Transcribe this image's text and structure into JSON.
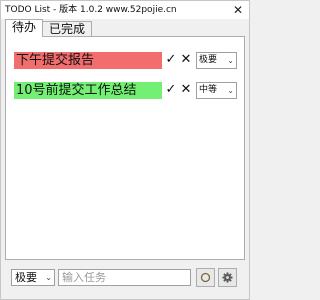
{
  "window": {
    "title": "TODO List - 版本 1.0.2 www.52pojie.cn",
    "close_label": "✕"
  },
  "tabs": [
    {
      "label": "待办",
      "selected": true
    },
    {
      "label": "已完成",
      "selected": false
    }
  ],
  "tasks": [
    {
      "text": "下午提交报告",
      "priority": "极要",
      "color": "#f26d6d",
      "done_label": "✓",
      "delete_label": "✕"
    },
    {
      "text": "10号前提交工作总结",
      "priority": "中等",
      "color": "#73f073",
      "done_label": "✓",
      "delete_label": "✕"
    }
  ],
  "new_task": {
    "priority": "极要",
    "placeholder": "输入任务",
    "add_icon": "circle-icon",
    "settings_icon": "gear-icon"
  },
  "colors": {
    "window_bg": "#f0f0f0",
    "panel_bg": "#ffffff",
    "border": "#adadad"
  }
}
